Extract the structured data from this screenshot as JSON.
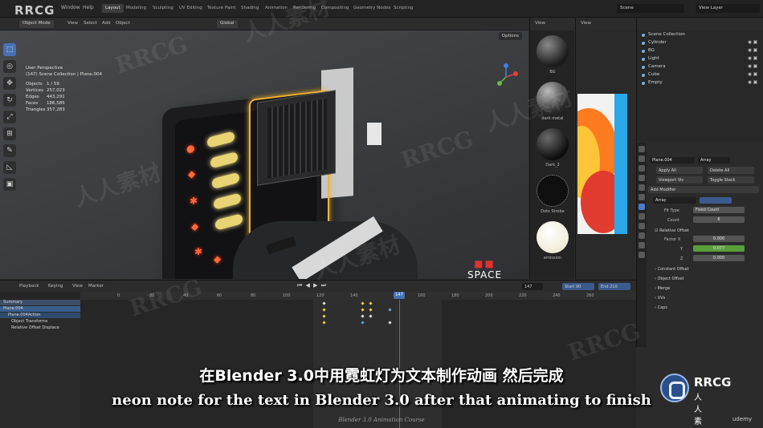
{
  "topbar": {
    "brand": "RRCG",
    "menu": [
      "Window",
      "Help"
    ],
    "workspaces": [
      "Layout",
      "Modeling",
      "Sculpting",
      "UV Editing",
      "Texture Paint",
      "Shading",
      "Animation",
      "Rendering",
      "Compositing",
      "Geometry Nodes",
      "Scripting"
    ],
    "active_workspace": "Layout",
    "scene": "Scene",
    "view_layer": "View Layer"
  },
  "viewport": {
    "mode": "Object Mode",
    "menus": [
      "View",
      "Select",
      "Add",
      "Object"
    ],
    "orientation": "Global",
    "options": "Options",
    "perspective": "User Perspective",
    "collection_path": "(147) Scene Collection | Plane.004",
    "stats": [
      {
        "label": "Objects",
        "value": "1 / 59"
      },
      {
        "label": "Vertices",
        "value": "257,023"
      },
      {
        "label": "Edges",
        "value": "443,291"
      },
      {
        "label": "Faces",
        "value": "186,585"
      },
      {
        "label": "Triangles",
        "value": "357,283"
      }
    ],
    "overlay_logo": {
      "mark": "■■",
      "text": "SPACE"
    }
  },
  "materials": {
    "header": "View",
    "items": [
      "BG",
      "dark metal",
      "Dark_2",
      "Dots Strobe",
      "emission"
    ]
  },
  "image_editor": {
    "header": "View"
  },
  "outliner": {
    "header": "Scene Collection",
    "rows": [
      "Scene Collection",
      "Cylinder",
      "BG",
      "Light",
      "Camera",
      "Cube",
      "Empty"
    ]
  },
  "properties": {
    "object": "Plane.004",
    "modifier_name": "Array",
    "apply_all": "Apply All",
    "delete_all": "Delete All",
    "viewport_vis": "Viewport Vis",
    "toggle_stack": "Toggle Stack",
    "add_modifier": "Add Modifier",
    "fit_type_label": "Fit Type",
    "fit_type": "Fixed Count",
    "count_label": "Count",
    "count": "6",
    "relative_offset": "Relative Offset",
    "factor_x_label": "Factor X",
    "factor_x": "0.000",
    "y_label": "Y",
    "factor_y": "0.077",
    "z_label": "Z",
    "factor_z": "0.000",
    "sections": [
      "Constant Offset",
      "Object Offset",
      "Merge",
      "UVs",
      "Caps"
    ]
  },
  "timeline": {
    "menus": [
      "Playback",
      "Keying",
      "View",
      "Marker"
    ],
    "current_frame": "147",
    "start_label": "Start",
    "start": "90",
    "end_label": "End",
    "end": "210",
    "ruler": [
      "0",
      "20",
      "40",
      "60",
      "80",
      "100",
      "120",
      "140",
      "160",
      "180",
      "200",
      "220",
      "240",
      "260"
    ],
    "channels": [
      "Summary",
      "Plane.004",
      "Plane.004Action",
      "Object Transforms",
      "Relative Offset Displace"
    ]
  },
  "subtitles": {
    "cn": "在Blender 3.0中用霓虹灯为文本制作动画 然后完成",
    "en": "neon note for the text in Blender 3.0 after that animating to finish"
  },
  "course_caption": "Blender 3.0 Animation Course",
  "watermark": {
    "rrcg": "RRCG",
    "cn": "人人素材"
  },
  "badge": {
    "name": "RRCG",
    "sub": "人人素材"
  },
  "udemy": "udemy"
}
